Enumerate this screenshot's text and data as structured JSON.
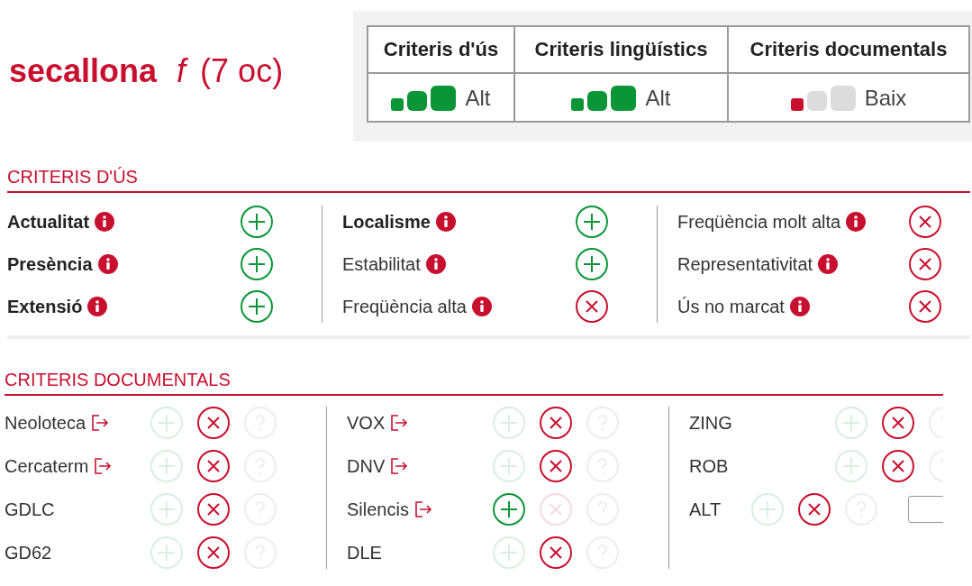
{
  "header": {
    "term": "secallona",
    "gender": "f",
    "count": "(7 oc)"
  },
  "summary": [
    {
      "heading": "Criteris d'ús",
      "stars": 3,
      "color": "#0a9637",
      "rating": "Alt"
    },
    {
      "heading": "Criteris lingüístics",
      "stars": 3,
      "color": "#0a9637",
      "rating": "Alt"
    },
    {
      "heading": "Criteris documentals",
      "stars": 1,
      "color": "#c8102e",
      "rating": "Baix"
    }
  ],
  "usage": {
    "title": "CRITERIS D'ÚS",
    "columns": [
      [
        {
          "label": "Actualitat",
          "bold": true,
          "positive": true
        },
        {
          "label": "Presència",
          "bold": true,
          "positive": true
        },
        {
          "label": "Extensió",
          "bold": true,
          "positive": true
        }
      ],
      [
        {
          "label": "Localisme",
          "bold": true,
          "positive": true
        },
        {
          "label": "Estabilitat",
          "bold": false,
          "positive": true
        },
        {
          "label": "Freqüència alta",
          "bold": false,
          "positive": false
        }
      ],
      [
        {
          "label": "Freqüència molt alta",
          "bold": false,
          "positive": false
        },
        {
          "label": "Representativitat",
          "bold": false,
          "positive": false
        },
        {
          "label": "Ús no marcat",
          "bold": false,
          "positive": false
        }
      ]
    ]
  },
  "documental": {
    "title": "CRITERIS DOCUMENTALS",
    "columns": [
      [
        {
          "label": "Neoloteca",
          "kind": "link",
          "found": false
        },
        {
          "label": "Cercaterm",
          "kind": "link",
          "found": false
        },
        {
          "label": "GDLC",
          "kind": "plain",
          "found": false
        },
        {
          "label": "GD62",
          "kind": "plain",
          "found": false
        }
      ],
      [
        {
          "label": "VOX",
          "kind": "link",
          "found": false
        },
        {
          "label": "DNV",
          "kind": "link",
          "found": false
        },
        {
          "label": "Silencis",
          "kind": "link",
          "found": true
        },
        {
          "label": "DLE",
          "kind": "plain",
          "found": false
        }
      ],
      [
        {
          "label": "ZING",
          "kind": "plain",
          "found": false
        },
        {
          "label": "ROB",
          "kind": "plain",
          "found": false
        },
        {
          "label": "ALT",
          "kind": "input",
          "found": false
        }
      ]
    ]
  }
}
